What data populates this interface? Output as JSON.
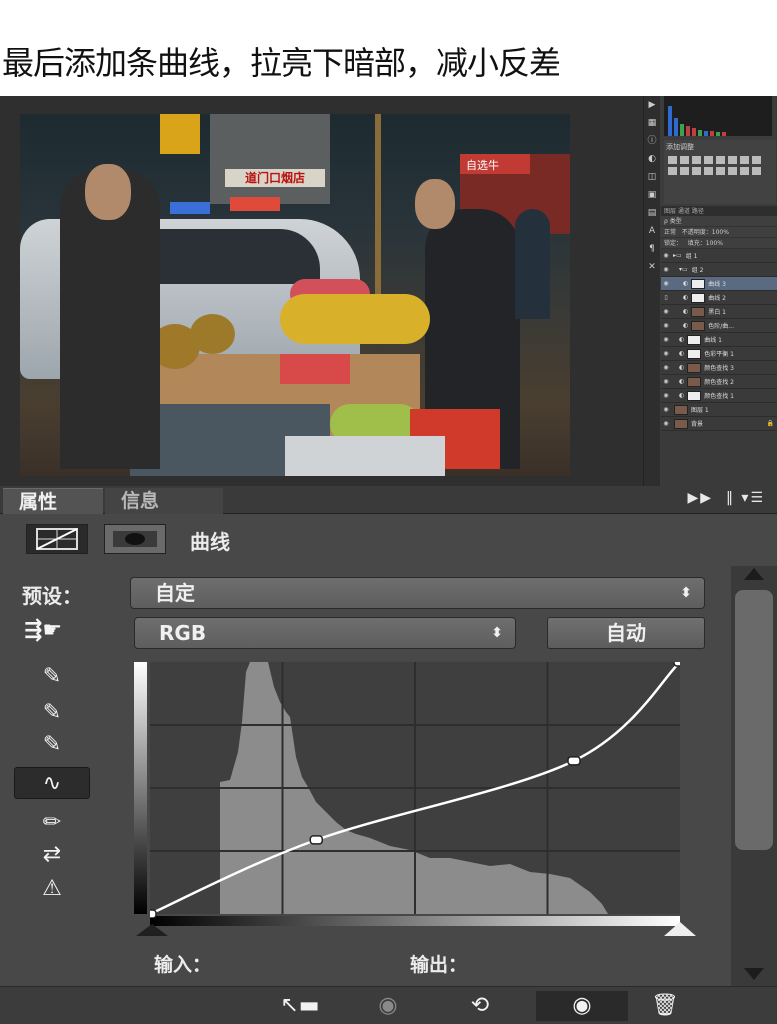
{
  "caption": "最后添加条曲线，拉亮下暗部，减小反差",
  "photo": {
    "shop_sign": "道门口烟店",
    "red_shop_sign": "自选牛",
    "layers_panel": {
      "adj_title": "添加调整",
      "tabs": "图层  通道  路径",
      "kind_label": "类型",
      "blend_mode": "正常",
      "opacity_label": "不透明度：",
      "opacity_value": "100%",
      "lock_label": "锁定：",
      "fill_label": "填充：",
      "fill_value": "100%",
      "layers": [
        {
          "name": "组 1",
          "type": "group"
        },
        {
          "name": "组 2",
          "type": "group"
        },
        {
          "name": "曲线 3",
          "type": "adjustment",
          "selected": true
        },
        {
          "name": "曲线 2",
          "type": "adjustment"
        },
        {
          "name": "黑白 1",
          "type": "adjustment"
        },
        {
          "name": "色阶/曲...",
          "type": "adjustment"
        },
        {
          "name": "曲线 1",
          "type": "adjustment"
        },
        {
          "name": "色彩平衡 1",
          "type": "adjustment"
        },
        {
          "name": "颜色查找 3",
          "type": "adjustment"
        },
        {
          "name": "颜色查找 2",
          "type": "adjustment"
        },
        {
          "name": "颜色查找 1",
          "type": "adjustment"
        },
        {
          "name": "图层 1",
          "type": "pixel"
        },
        {
          "name": "背景",
          "type": "pixel"
        }
      ]
    }
  },
  "properties_panel": {
    "tabs": [
      {
        "label": "属性",
        "active": true
      },
      {
        "label": "信息",
        "active": false
      }
    ],
    "adjustment_title": "曲线",
    "preset_label": "预设：",
    "preset_value": "自定",
    "channel_value": "RGB",
    "auto_button": "自动",
    "input_label": "输入：",
    "output_label": "输出：",
    "curve_points": [
      {
        "input": 0,
        "output": 0
      },
      {
        "input": 80,
        "output": 75
      },
      {
        "input": 204,
        "output": 155
      },
      {
        "input": 255,
        "output": 255
      }
    ],
    "tools": [
      {
        "icon": "eyedropper-black-icon"
      },
      {
        "icon": "eyedropper-gray-icon"
      },
      {
        "icon": "eyedropper-white-icon"
      },
      {
        "icon": "curve-edit-icon",
        "active": true
      },
      {
        "icon": "pencil-icon"
      },
      {
        "icon": "smooth-icon"
      },
      {
        "icon": "clipping-warning-icon"
      }
    ],
    "bottom_icons": [
      "clip-to-layer-icon",
      "view-previous-icon",
      "reset-icon",
      "visibility-icon",
      "trash-icon"
    ],
    "colors": {
      "panel_bg": "#484848",
      "graph_bg": "#3f3f3f",
      "histogram": "#8c8c8c",
      "curve": "#ffffff"
    }
  }
}
